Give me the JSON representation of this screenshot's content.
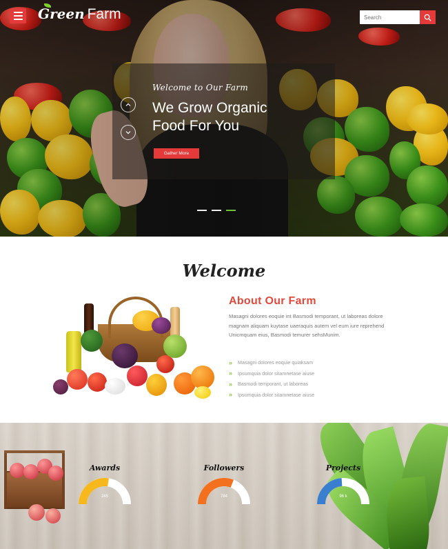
{
  "header": {
    "logo_script": "Green",
    "logo_text": "Farm",
    "search_placeholder": "Search"
  },
  "hero": {
    "subtitle": "Welcome to Our Farm",
    "title": "We Grow Organic Food For You",
    "button_label": "Gather More",
    "slides": 3,
    "active_slide": 3
  },
  "about": {
    "heading": "Welcome",
    "title": "About Our Farm",
    "text": "Masagni dolores eoquie int Basmodi temporant, ut laboreas dolore magnam aliquam kuytase uaeraquis autem vel eum iure reprehend Unicmquam eius, Basmodi temurer sehsMunim.",
    "list": [
      "Masagni dolores eoquie quiaksam",
      "Ipsumquia dolor sitamnetase aiuse",
      "Basmodi temporant, ut laboreas",
      "Ipsumquia dolor sitamnetase aiuse"
    ]
  },
  "stats": [
    {
      "label": "Awards",
      "value": "245",
      "percent": 55,
      "color": "#f6b81d"
    },
    {
      "label": "Followers",
      "value": "784",
      "percent": 62,
      "color": "#f2701e"
    },
    {
      "label": "Projects",
      "value": "96 k",
      "percent": 48,
      "color": "#3a7fcf"
    }
  ],
  "colors": {
    "accent": "#e53a3a",
    "about_title": "#e3493a",
    "list_bullet": "#8cc63f",
    "active_dot": "#6ec23a"
  }
}
